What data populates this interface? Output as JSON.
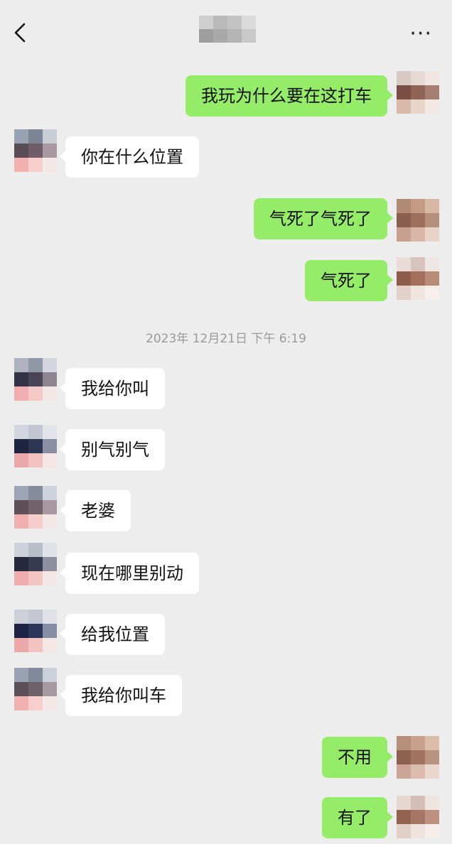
{
  "header": {
    "back_icon": "chevron-left-icon",
    "more_label": "···"
  },
  "timestamp": "2023年 12月21日  下午 6:19",
  "colors": {
    "outgoing_bubble": "#95ec69",
    "incoming_bubble": "#ffffff",
    "background": "#ededed"
  },
  "messages": [
    {
      "dir": "out",
      "text": "我玩为什么要在这打车"
    },
    {
      "dir": "in",
      "text": "你在什么位置"
    },
    {
      "dir": "out",
      "text": "气死了气死了"
    },
    {
      "dir": "out",
      "text": "气死了"
    },
    {
      "dir": "in",
      "text": "我给你叫"
    },
    {
      "dir": "in",
      "text": "别气别气"
    },
    {
      "dir": "in",
      "text": "老婆"
    },
    {
      "dir": "in",
      "text": "现在哪里别动"
    },
    {
      "dir": "in",
      "text": "给我位置"
    },
    {
      "dir": "in",
      "text": "我给你叫车"
    },
    {
      "dir": "out",
      "text": "不用"
    },
    {
      "dir": "out",
      "text": "有了"
    }
  ]
}
